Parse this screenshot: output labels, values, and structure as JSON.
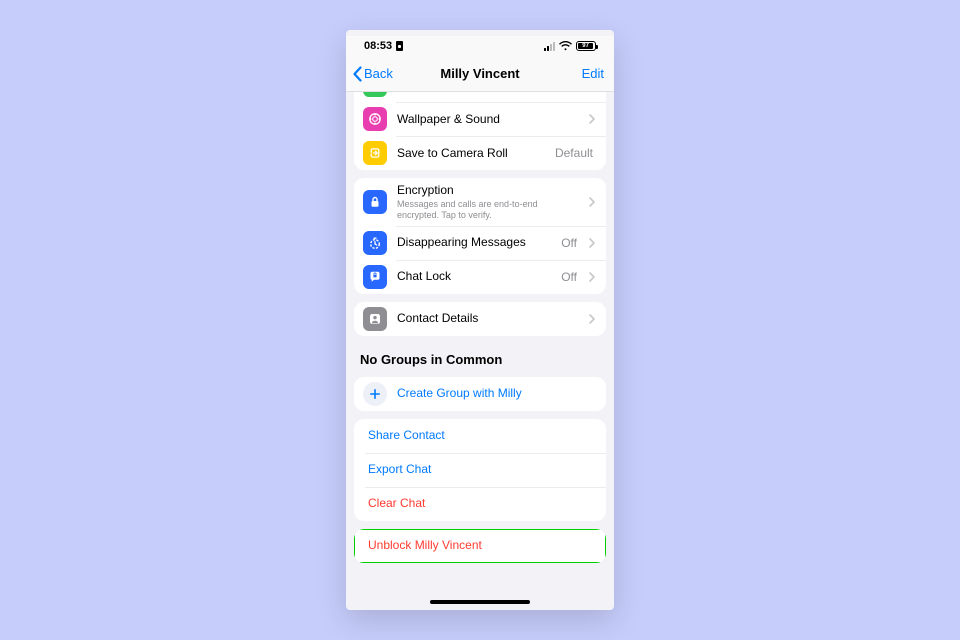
{
  "status": {
    "time": "08:53",
    "battery": "97"
  },
  "nav": {
    "back": "Back",
    "title": "Milly Vincent",
    "edit": "Edit"
  },
  "g1": {
    "wallpaper": "Wallpaper & Sound",
    "save": "Save to Camera Roll",
    "save_detail": "Default"
  },
  "g2": {
    "enc_title": "Encryption",
    "enc_sub": "Messages and calls are end-to-end encrypted. Tap to verify.",
    "disappear": "Disappearing Messages",
    "disappear_detail": "Off",
    "chatlock": "Chat Lock",
    "chatlock_detail": "Off"
  },
  "g3": {
    "details": "Contact Details"
  },
  "groups": {
    "header": "No Groups in Common",
    "create": "Create Group with Milly"
  },
  "actions": {
    "share": "Share Contact",
    "export": "Export Chat",
    "clear": "Clear Chat"
  },
  "unblock": "Unblock Milly Vincent",
  "colors": {
    "accent": "#007aff",
    "danger": "#ff3b30",
    "magenta": "#e83eaf",
    "yellow": "#ffcc00",
    "blue_icon": "#2968ff",
    "grey_icon": "#8e8e93"
  }
}
